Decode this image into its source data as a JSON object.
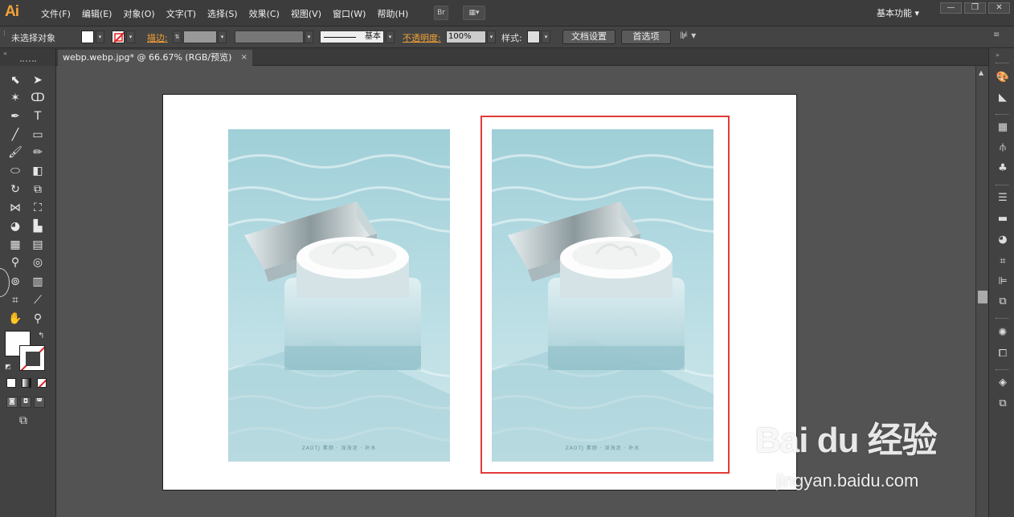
{
  "app": {
    "logo": "Ai",
    "menu": [
      "文件(F)",
      "编辑(E)",
      "对象(O)",
      "文字(T)",
      "选择(S)",
      "效果(C)",
      "视图(V)",
      "窗口(W)",
      "帮助(H)"
    ],
    "bridge_button": "Br",
    "workspace": "基本功能",
    "window_controls": [
      "—",
      "❐",
      "✕"
    ]
  },
  "control_bar": {
    "selection_state": "未选择对象",
    "stroke_label": "描边:",
    "brush_label": "基本",
    "opacity_label": "不透明度:",
    "opacity_value": "100%",
    "style_label": "样式:",
    "doc_setup_button": "文档设置",
    "preferences_button": "首选项"
  },
  "document": {
    "tab_title": "webp.webp.jpg* @ 66.67% (RGB/预览)",
    "tab_close": "×"
  },
  "artboard": {
    "product_caption": "ZAOTJ 素颜 · 深海泥 · 补水"
  },
  "watermark": {
    "brand": "Bai du 经验",
    "url": "jingyan.baidu.com"
  },
  "colors": {
    "accent_orange": "#f3a236",
    "selection_red": "#e23a3a",
    "water_blue": "#8fc3ce"
  }
}
